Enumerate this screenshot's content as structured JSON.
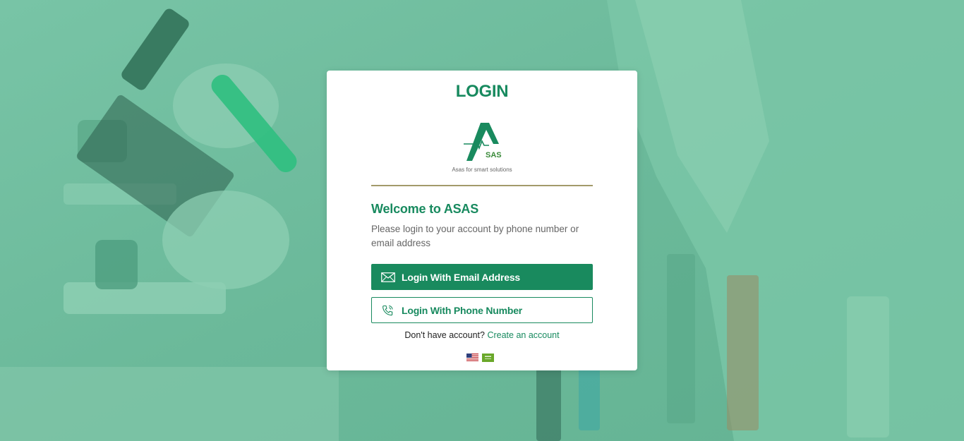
{
  "login": {
    "title": "LOGIN",
    "logo_text": "SAS",
    "tagline": "Asas for smart solutions",
    "welcome": "Welcome to ASAS",
    "subtitle": "Please login to your account by phone number or email address",
    "email_button_label": "Login With Email Address",
    "phone_button_label": "Login With Phone Number",
    "signup_prompt": "Don't have account?",
    "signup_link": "Create an account"
  },
  "languages": [
    {
      "name": "english",
      "icon": "us-flag-icon"
    },
    {
      "name": "arabic",
      "icon": "saudi-flag-icon"
    }
  ],
  "colors": {
    "brand_green": "#198a5e",
    "background_tint": "#6fbd9d",
    "divider": "#a39a6a",
    "card": "#ffffff"
  }
}
